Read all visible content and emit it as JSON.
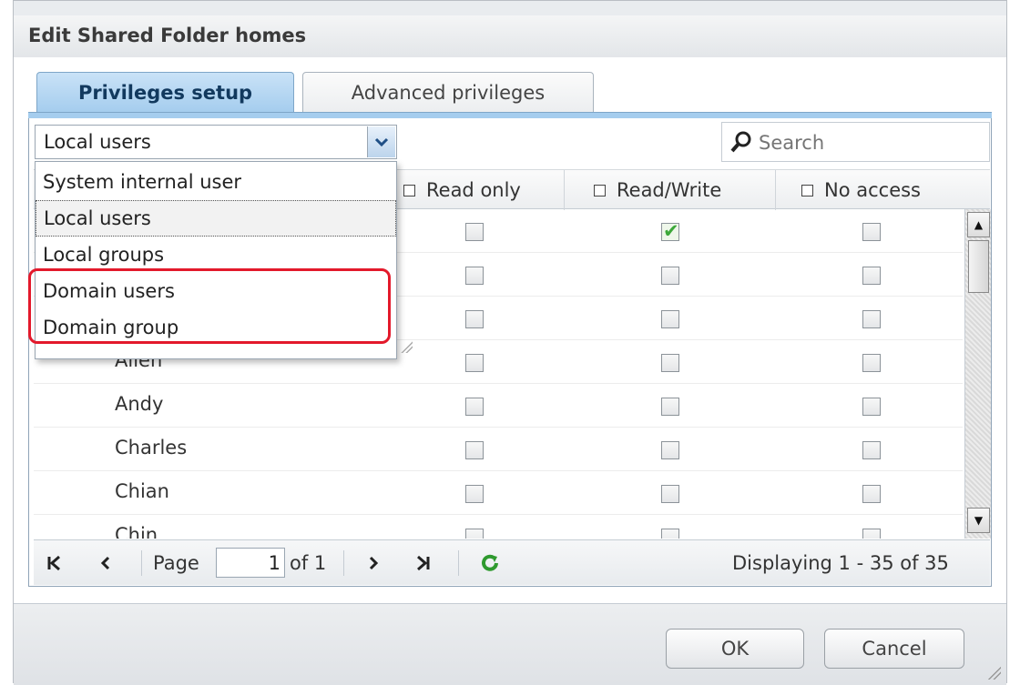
{
  "window": {
    "title": "Edit Shared Folder homes"
  },
  "tabs": [
    {
      "label": "Privileges setup",
      "active": true
    },
    {
      "label": "Advanced privileges",
      "active": false
    }
  ],
  "user_type_select": {
    "value": "Local users",
    "options": [
      "System internal user",
      "Local users",
      "Local groups",
      "Domain users",
      "Domain group"
    ],
    "selected_index": 1,
    "highlighted_options": [
      "Domain users",
      "Domain group"
    ]
  },
  "search": {
    "placeholder": "Search",
    "icon": "search-icon"
  },
  "columns": [
    "Read only",
    "Read/Write",
    "No access"
  ],
  "rows": [
    {
      "name": "",
      "read_only": false,
      "read_write": true,
      "no_access": false
    },
    {
      "name": "",
      "read_only": false,
      "read_write": false,
      "no_access": false
    },
    {
      "name": "",
      "read_only": false,
      "read_write": false,
      "no_access": false
    },
    {
      "name": "Allen",
      "read_only": false,
      "read_write": false,
      "no_access": false
    },
    {
      "name": "Andy",
      "read_only": false,
      "read_write": false,
      "no_access": false
    },
    {
      "name": "Charles",
      "read_only": false,
      "read_write": false,
      "no_access": false
    },
    {
      "name": "Chian",
      "read_only": false,
      "read_write": false,
      "no_access": false
    },
    {
      "name": "Chin",
      "read_only": false,
      "read_write": false,
      "no_access": false
    }
  ],
  "pager": {
    "page_label": "Page",
    "page_value": "1",
    "of_label": "of 1",
    "display_text": "Displaying 1 - 35 of 35"
  },
  "buttons": {
    "ok": "OK",
    "cancel": "Cancel"
  },
  "colors": {
    "tab_active": "#a5cdee",
    "check_green": "#3ca83a",
    "refresh_green": "#2f9a2f",
    "highlight_red": "#e3192b"
  }
}
